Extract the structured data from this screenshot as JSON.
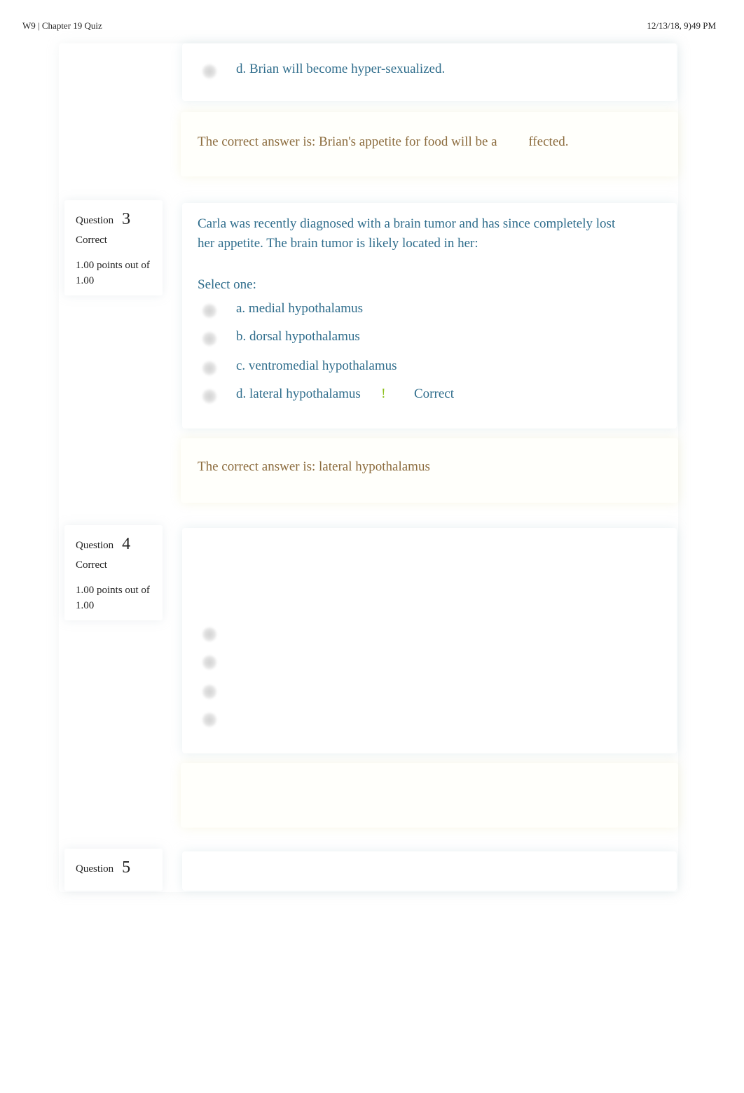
{
  "header": {
    "title": "W9 | Chapter 19 Quiz",
    "datetime": "12/13/18, 9)49 PM"
  },
  "question2_tail": {
    "answer_d": "d. Brian will become hyper-sexualized.",
    "feedback_part1": "The correct answer is: Brian's appetite for food will be a",
    "feedback_part2": "ffected."
  },
  "question3": {
    "label": "Question",
    "number": "3",
    "state": "Correct",
    "grade": "1.00 points out of 1.00",
    "text": "Carla was recently diagnosed with a brain tumor and has since completely lost her appetite. The brain tumor is likely located in her:",
    "prompt": "Select one:",
    "answers": [
      {
        "label": "a. medial hypothalamus"
      },
      {
        "label": "b. dorsal hypothalamus"
      },
      {
        "label": "c. ventromedial hypothalamus"
      },
      {
        "label": "d. lateral hypothalamus",
        "selected_mark": "!",
        "result": "Correct"
      }
    ],
    "feedback": "The correct answer is: lateral hypothalamus"
  },
  "question4": {
    "label": "Question",
    "number": "4",
    "state": "Correct",
    "grade": "1.00 points out of 1.00",
    "answer_count": 4
  },
  "question5": {
    "label": "Question",
    "number": "5"
  },
  "colors": {
    "question_text": "#2f6d8c",
    "feedback_text": "#8c6c3e",
    "correct_mark": "#8cbf1a"
  }
}
